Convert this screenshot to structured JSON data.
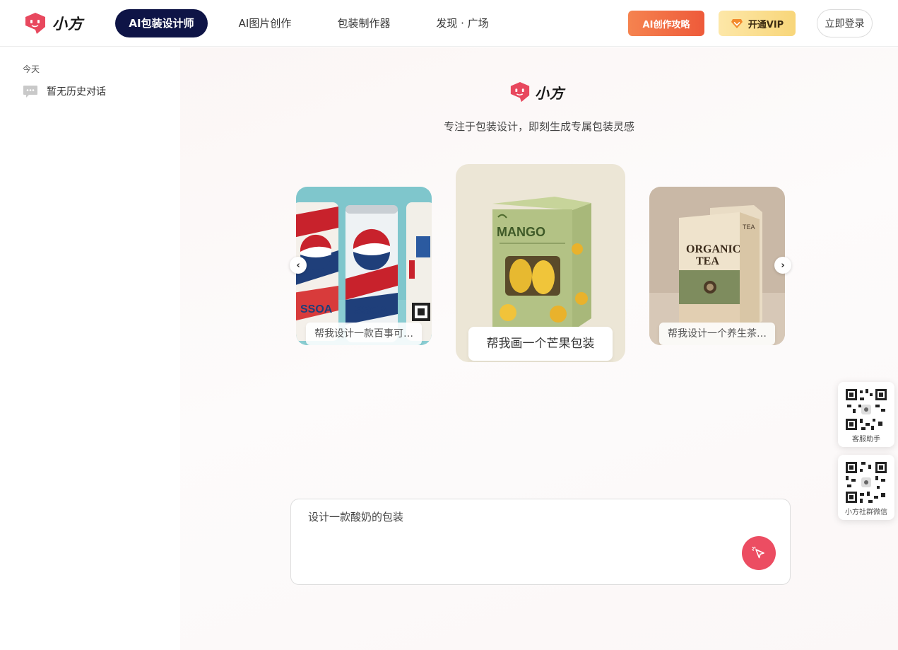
{
  "brand": {
    "name": "小方",
    "accent": "#e8485e",
    "nav_dark": "#0e1446"
  },
  "header": {
    "tabs": [
      {
        "label": "AI包装设计师",
        "active": true
      },
      {
        "label": "AI图片创作",
        "active": false
      },
      {
        "label": "包装制作器",
        "active": false
      },
      {
        "label": "发现 · 广场",
        "active": false
      }
    ],
    "guide_button": "AI创作攻略",
    "vip_button": "开通VIP",
    "login_button": "立即登录"
  },
  "sidebar": {
    "section_label": "今天",
    "empty_history": "暂无历史对话"
  },
  "main": {
    "tagline": "专注于包装设计，即刻生成专属包装灵感",
    "cards": [
      {
        "caption": "帮我设计一款百事可乐的包装",
        "image": "soda-cans"
      },
      {
        "caption": "帮我画一个芒果包装",
        "image": "mango-box"
      },
      {
        "caption": "帮我设计一个养生茶包装",
        "image": "organic-tea-box"
      }
    ],
    "input_placeholder": "设计一款酸奶的包装"
  },
  "floating": {
    "service_label": "客服助手",
    "community_label": "小方社群微信"
  }
}
